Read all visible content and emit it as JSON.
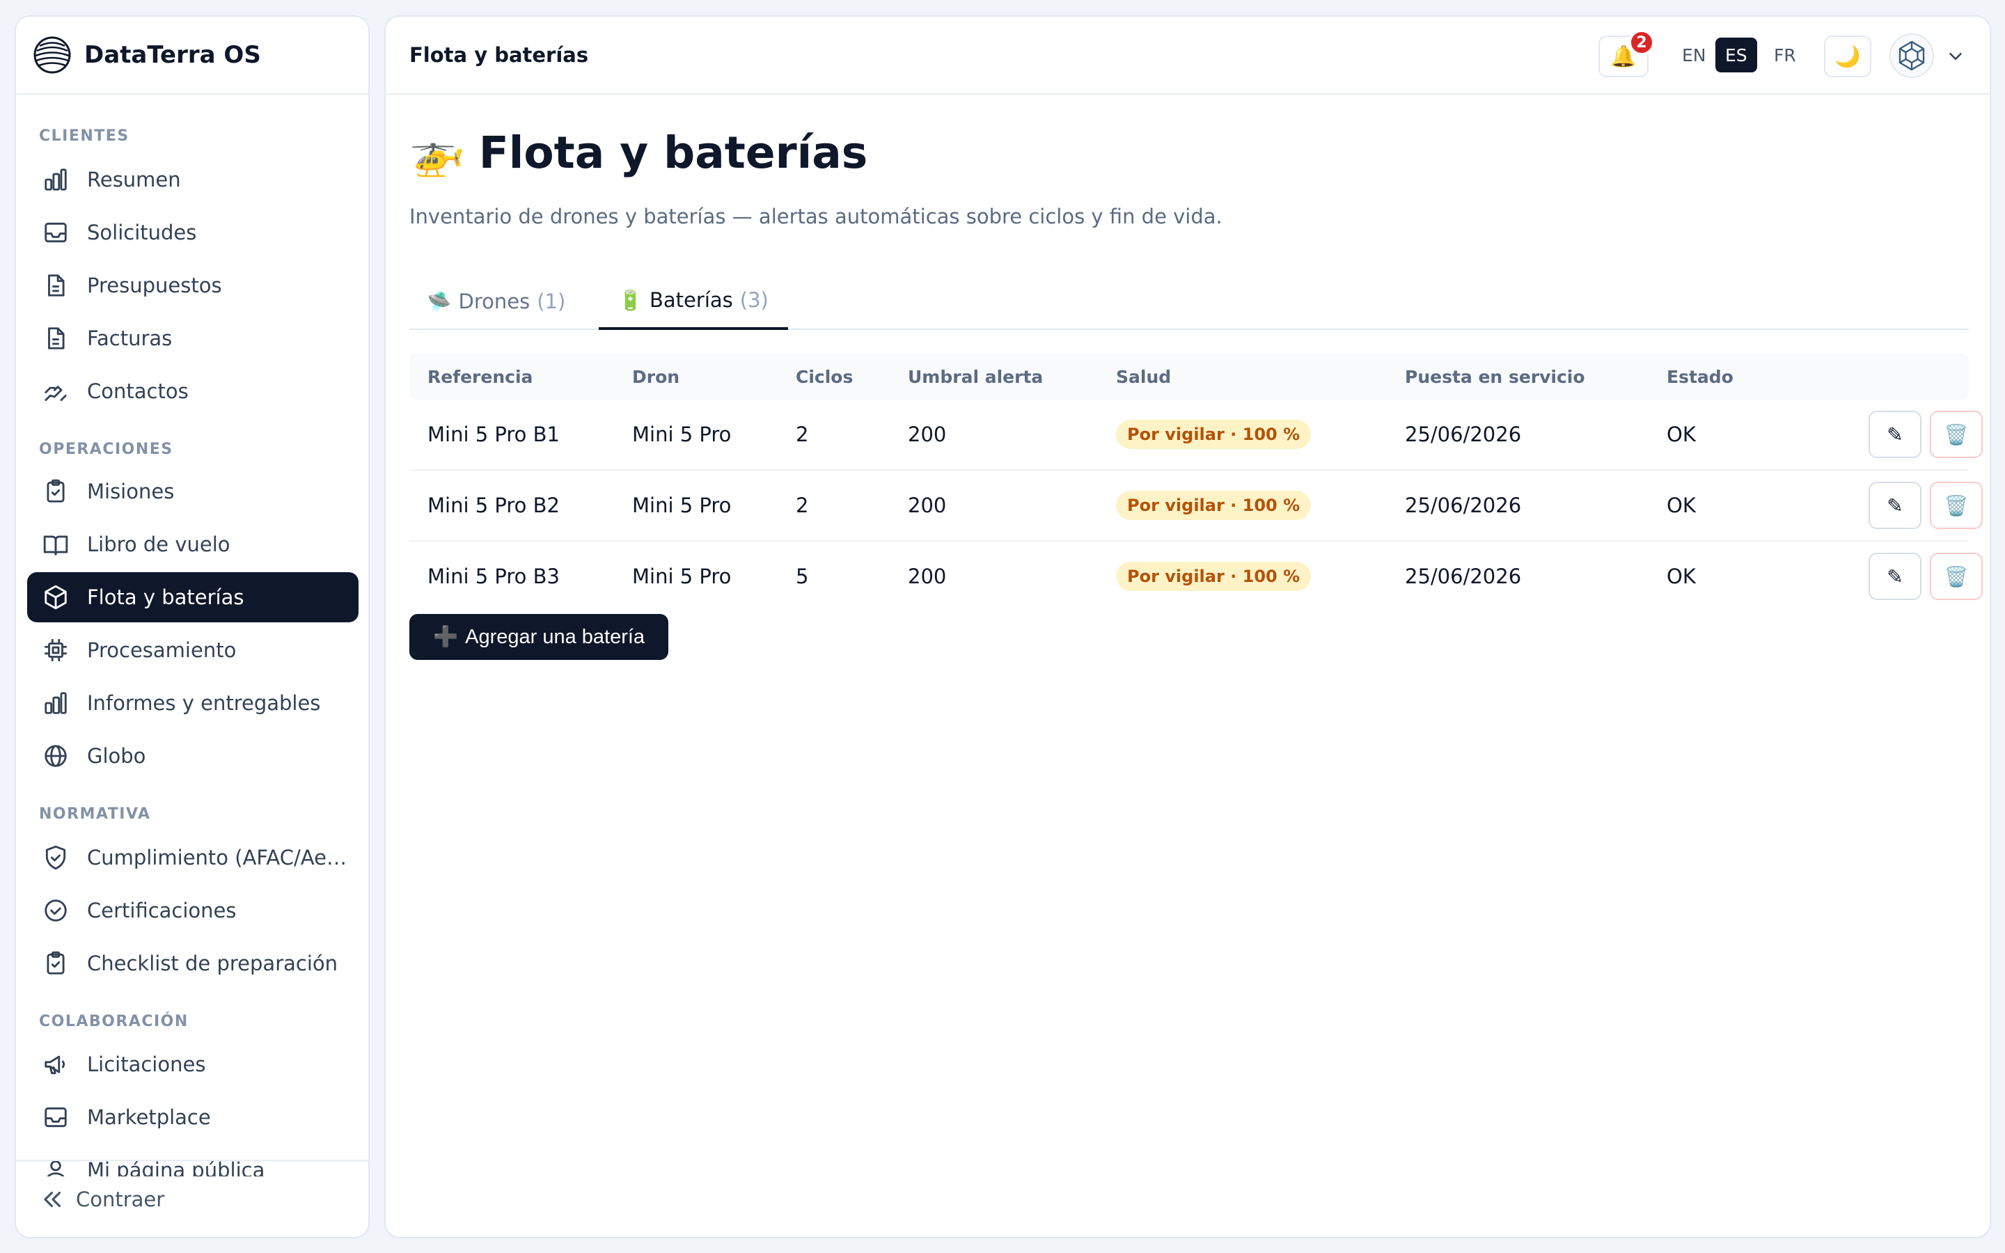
{
  "brand": {
    "name": "DataTerra OS"
  },
  "sidebar": {
    "sections": [
      {
        "label": "CLIENTES"
      },
      {
        "label": "OPERACIONES"
      },
      {
        "label": "NORMATIVA"
      },
      {
        "label": "COLABORACIÓN"
      }
    ],
    "items": [
      {
        "label": "Resumen",
        "icon": "bar-chart-icon"
      },
      {
        "label": "Solicitudes",
        "icon": "inbox-icon"
      },
      {
        "label": "Presupuestos",
        "icon": "document-icon"
      },
      {
        "label": "Facturas",
        "icon": "document-icon"
      },
      {
        "label": "Contactos",
        "icon": "handshake-icon"
      },
      {
        "label": "Misiones",
        "icon": "clipboard-check-icon"
      },
      {
        "label": "Libro de vuelo",
        "icon": "book-open-icon"
      },
      {
        "label": "Flota y baterías",
        "icon": "package-icon",
        "active": true
      },
      {
        "label": "Procesamiento",
        "icon": "cpu-icon"
      },
      {
        "label": "Informes y entregables",
        "icon": "bar-chart-icon"
      },
      {
        "label": "Globo",
        "icon": "globe-icon"
      },
      {
        "label": "Cumplimiento (AFAC/Aer...",
        "icon": "shield-check-icon"
      },
      {
        "label": "Certificaciones",
        "icon": "check-circle-icon"
      },
      {
        "label": "Checklist de preparación",
        "icon": "clipboard-check-icon"
      },
      {
        "label": "Licitaciones",
        "icon": "megaphone-icon"
      },
      {
        "label": "Marketplace",
        "icon": "inbox-icon"
      },
      {
        "label": "Mi página pública",
        "icon": "user-icon"
      }
    ],
    "collapse_label": "Contraer"
  },
  "header": {
    "title": "Flota y baterías",
    "notification_count": "2",
    "languages": [
      {
        "code": "EN"
      },
      {
        "code": "ES",
        "active": true
      },
      {
        "code": "FR"
      }
    ],
    "bell_icon": "🔔",
    "theme_icon": "🌙"
  },
  "page": {
    "emoji": "🚁",
    "title": "Flota y baterías",
    "subtitle": "Inventario de drones y baterías — alertas automáticas sobre ciclos y fin de vida."
  },
  "tabs": [
    {
      "emoji": "🛸",
      "label": "Drones",
      "count": "(1)"
    },
    {
      "emoji": "🔋",
      "label": "Baterías",
      "count": "(3)",
      "active": true
    }
  ],
  "table": {
    "columns": [
      "Referencia",
      "Dron",
      "Ciclos",
      "Umbral alerta",
      "Salud",
      "Puesta en servicio",
      "Estado"
    ],
    "rows": [
      {
        "ref": "Mini 5 Pro B1",
        "drone": "Mini 5 Pro",
        "cycles": "2",
        "threshold": "200",
        "health": "Por vigilar · 100 %",
        "service_date": "25/06/2026",
        "status": "OK"
      },
      {
        "ref": "Mini 5 Pro B2",
        "drone": "Mini 5 Pro",
        "cycles": "2",
        "threshold": "200",
        "health": "Por vigilar · 100 %",
        "service_date": "25/06/2026",
        "status": "OK"
      },
      {
        "ref": "Mini 5 Pro B3",
        "drone": "Mini 5 Pro",
        "cycles": "5",
        "threshold": "200",
        "health": "Por vigilar · 100 %",
        "service_date": "25/06/2026",
        "status": "OK"
      }
    ],
    "edit_icon": "✎",
    "delete_icon": "🗑️"
  },
  "actions": {
    "add_emoji": "➕",
    "add_label": "Agregar una batería"
  },
  "colors": {
    "primary": "#0f172a",
    "badge": "#dc2626",
    "pill_bg": "#fef3c7",
    "pill_text": "#b45309"
  }
}
